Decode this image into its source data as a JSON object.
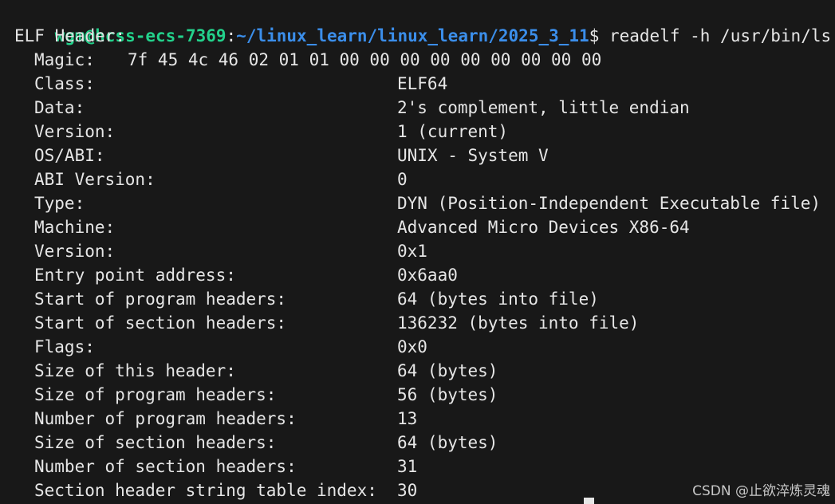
{
  "prompt": {
    "user_host": "wgm@hcss-ecs-7369",
    "colon": ":",
    "path": "~/linux_learn/linux_learn/2025_3_11",
    "dollar": "$",
    "command": " readelf -h /usr/bin/ls"
  },
  "header_title": "ELF Header:",
  "magic": {
    "label": "Magic:",
    "bytes": "7f 45 4c 46 02 01 01 00 00 00 00 00 00 00 00 00"
  },
  "fields": [
    {
      "label": "Class:",
      "value": "ELF64"
    },
    {
      "label": "Data:",
      "value": "2's complement, little endian"
    },
    {
      "label": "Version:",
      "value": "1 (current)"
    },
    {
      "label": "OS/ABI:",
      "value": "UNIX - System V"
    },
    {
      "label": "ABI Version:",
      "value": "0"
    },
    {
      "label": "Type:",
      "value": "DYN (Position-Independent Executable file)"
    },
    {
      "label": "Machine:",
      "value": "Advanced Micro Devices X86-64"
    },
    {
      "label": "Version:",
      "value": "0x1"
    },
    {
      "label": "Entry point address:",
      "value": "0x6aa0"
    },
    {
      "label": "Start of program headers:",
      "value": "64 (bytes into file)"
    },
    {
      "label": "Start of section headers:",
      "value": "136232 (bytes into file)"
    },
    {
      "label": "Flags:",
      "value": "0x0"
    },
    {
      "label": "Size of this header:",
      "value": "64 (bytes)"
    },
    {
      "label": "Size of program headers:",
      "value": "56 (bytes)"
    },
    {
      "label": "Number of program headers:",
      "value": "13"
    },
    {
      "label": "Size of section headers:",
      "value": "64 (bytes)"
    },
    {
      "label": "Number of section headers:",
      "value": "31"
    },
    {
      "label": "Section header string table index:",
      "value": "30"
    }
  ],
  "watermark": "CSDN @止欲淬炼灵魂",
  "colors": {
    "background": "#181818",
    "text": "#e6e6e6",
    "prompt_user": "#23d18b",
    "prompt_path": "#3b8eea"
  }
}
